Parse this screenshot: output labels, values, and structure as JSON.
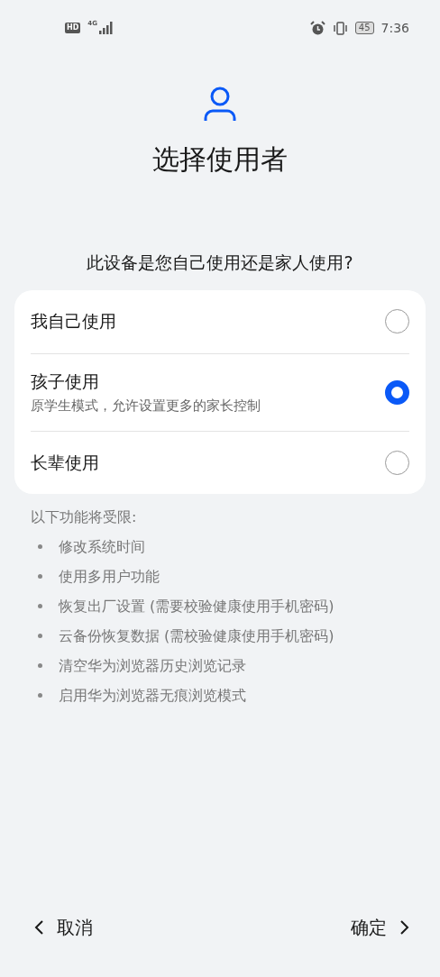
{
  "status_bar": {
    "badge": "HD",
    "network": "4G",
    "battery": "45",
    "time": "7:36"
  },
  "title": "选择使用者",
  "question": "此设备是您自己使用还是家人使用?",
  "options": [
    {
      "label": "我自己使用",
      "selected": false
    },
    {
      "label": "孩子使用",
      "description": "原学生模式，允许设置更多的家长控制",
      "selected": true
    },
    {
      "label": "长辈使用",
      "selected": false
    }
  ],
  "restrictions": {
    "heading": "以下功能将受限:",
    "items": [
      "修改系统时间",
      "使用多用户功能",
      "恢复出厂设置 (需要校验健康使用手机密码)",
      "云备份恢复数据 (需校验健康使用手机密码)",
      "清空华为浏览器历史浏览记录",
      "启用华为浏览器无痕浏览模式"
    ]
  },
  "footer": {
    "cancel": "取消",
    "confirm": "确定"
  }
}
